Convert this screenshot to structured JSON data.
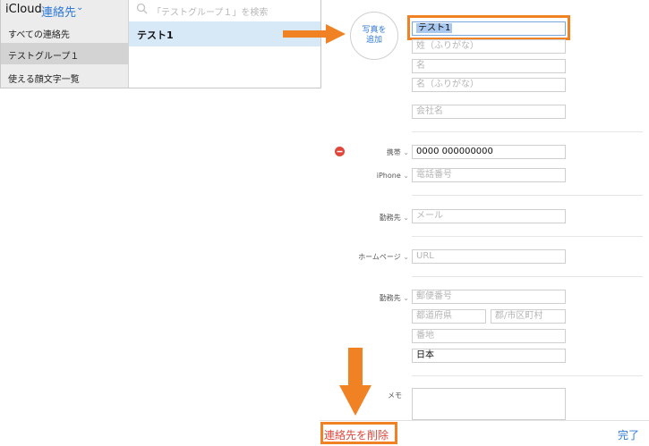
{
  "sidebar": {
    "brand": "iCloud",
    "group": "連絡先",
    "chevron": "⌄",
    "items": [
      {
        "label": "すべての連絡先"
      },
      {
        "label": "テストグループ１"
      },
      {
        "label": "使える顔文字一覧"
      }
    ]
  },
  "list": {
    "search_placeholder": "「テストグループ１」を検索",
    "selected": "テスト1"
  },
  "photo": {
    "line1": "写真を",
    "line2": "追加"
  },
  "name_fields": {
    "last_name": "テスト1",
    "last_phonetic_placeholder": "姓（ふりがな）",
    "first_placeholder": "名",
    "first_phonetic_placeholder": "名（ふりがな）",
    "company_placeholder": "会社名"
  },
  "phones": [
    {
      "label": "携帯",
      "value": "0000 000000000"
    },
    {
      "label": "iPhone",
      "placeholder": "電話番号"
    }
  ],
  "email": {
    "label": "勤務先",
    "placeholder": "メール"
  },
  "url": {
    "label": "ホームページ",
    "placeholder": "URL"
  },
  "address": {
    "label": "勤務先",
    "postal_placeholder": "郵便番号",
    "prefecture_placeholder": "都道府県",
    "city_placeholder": "郡/市区町村",
    "street_placeholder": "番地",
    "country": "日本"
  },
  "memo": {
    "label": "メモ"
  },
  "footer": {
    "delete_label": "連絡先を削除",
    "done_label": "完了"
  },
  "colors": {
    "accent": "#2f7ad6",
    "delete": "#e0463a",
    "annotation": "#f08223"
  }
}
